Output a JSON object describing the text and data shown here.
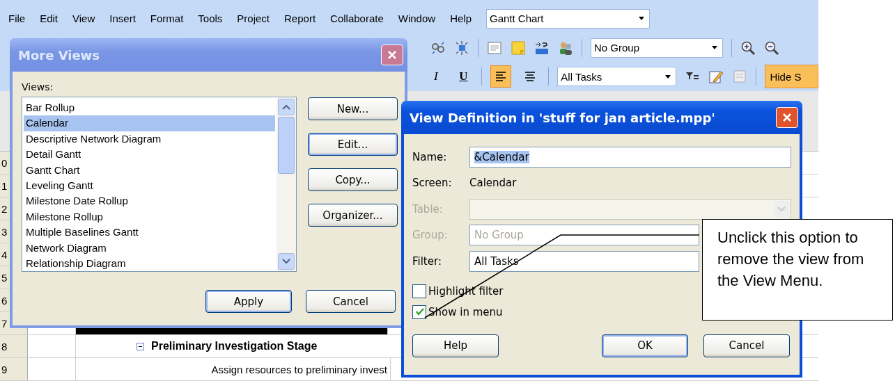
{
  "menu_bar": {
    "items": [
      "File",
      "Edit",
      "View",
      "Insert",
      "Format",
      "Tools",
      "Project",
      "Report",
      "Collaborate",
      "Window",
      "Help"
    ],
    "view_combo": "Gantt Chart"
  },
  "toolbar_1": {
    "group_combo": "No Group"
  },
  "toolbar_2": {
    "format_buttons": [
      {
        "label": "I",
        "kind": "italic"
      },
      {
        "label": "U",
        "kind": "underline"
      }
    ],
    "align_buttons": [
      {
        "selected": true
      },
      {
        "selected": false
      }
    ],
    "filter_combo": "All Tasks",
    "hide_button": "Hide S"
  },
  "gantt": {
    "rows": [
      {
        "number": "0",
        "kind": "blank"
      },
      {
        "number": "1",
        "kind": "blank"
      },
      {
        "number": "2",
        "kind": "blank"
      },
      {
        "number": "3",
        "kind": "blank"
      },
      {
        "number": "4",
        "kind": "blank"
      },
      {
        "number": "5",
        "kind": "blank"
      },
      {
        "number": "6",
        "kind": "blank"
      },
      {
        "number": "7",
        "kind": "highlight"
      },
      {
        "number": "8",
        "kind": "summary",
        "name": "Preliminary Investigation Stage",
        "expanded": true
      },
      {
        "number": "9",
        "kind": "task",
        "name": "Assign resources to preliminary invest"
      }
    ]
  },
  "more_views": {
    "title": "More Views",
    "active": false,
    "list_label": "Views:",
    "items": [
      {
        "label": "Bar Rollup",
        "selected": false
      },
      {
        "label": "Calendar",
        "selected": true
      },
      {
        "label": "Descriptive Network Diagram",
        "selected": false
      },
      {
        "label": "Detail Gantt",
        "selected": false
      },
      {
        "label": "Gantt Chart",
        "selected": false
      },
      {
        "label": "Leveling Gantt",
        "selected": false
      },
      {
        "label": "Milestone Date Rollup",
        "selected": false
      },
      {
        "label": "Milestone Rollup",
        "selected": false
      },
      {
        "label": "Multiple Baselines Gantt",
        "selected": false
      },
      {
        "label": "Network Diagram",
        "selected": false
      },
      {
        "label": "Relationship Diagram",
        "selected": false
      }
    ],
    "side_buttons": [
      {
        "label": "New...",
        "focused": false
      },
      {
        "label": "Edit...",
        "focused": true
      },
      {
        "label": "Copy...",
        "focused": false
      },
      {
        "label": "Organizer...",
        "focused": false
      }
    ],
    "apply_button": "Apply",
    "cancel_button": "Cancel"
  },
  "view_definition": {
    "title": "View Definition in 'stuff for jan article.mpp'",
    "active": true,
    "fields": [
      {
        "label": "Name:",
        "kind": "input",
        "value": "&Calendar",
        "value_selected": true,
        "disabled": false
      },
      {
        "label": "Screen:",
        "kind": "text",
        "value": "Calendar",
        "disabled": false
      },
      {
        "label": "Table:",
        "kind": "select",
        "disabled": true
      },
      {
        "label": "Group:",
        "kind": "input",
        "value": "No Group",
        "disabled": true
      },
      {
        "label": "Filter:",
        "kind": "input",
        "value": "All Tasks",
        "disabled": false
      }
    ],
    "checkboxes": [
      {
        "label": "Highlight filter",
        "checked": false
      },
      {
        "label": "Show in menu",
        "checked": true
      }
    ],
    "help_button": "Help",
    "ok_button": "OK",
    "cancel_button": "Cancel"
  },
  "callout": {
    "text": "Unclick this option to remove the view from the View Menu."
  }
}
